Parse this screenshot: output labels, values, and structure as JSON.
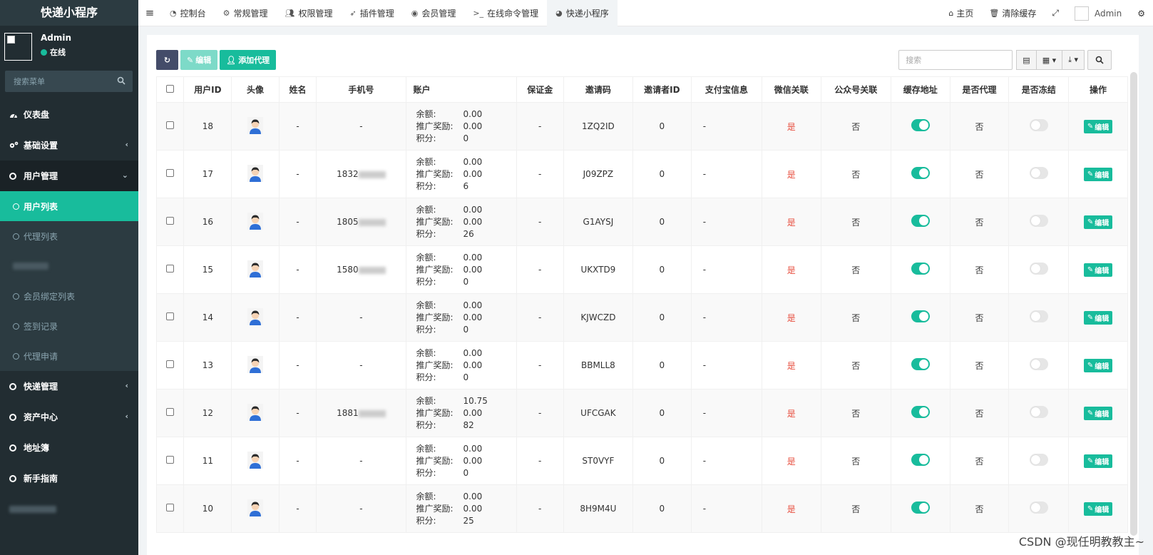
{
  "app": {
    "title": "快递小程序"
  },
  "user": {
    "name": "Admin",
    "status": "在线"
  },
  "sidebar": {
    "search_placeholder": "搜索菜单",
    "items": [
      {
        "label": "仪表盘"
      },
      {
        "label": "基础设置"
      },
      {
        "label": "用户管理"
      },
      {
        "label": "快递管理"
      },
      {
        "label": "资产中心"
      },
      {
        "label": "地址簿"
      },
      {
        "label": "新手指南"
      }
    ],
    "submenu": [
      {
        "label": "用户列表"
      },
      {
        "label": "代理列表"
      },
      {
        "label": "会员绑定列表"
      },
      {
        "label": "签到记录"
      },
      {
        "label": "代理申请"
      }
    ]
  },
  "topnav": {
    "tabs": [
      {
        "label": "控制台"
      },
      {
        "label": "常规管理"
      },
      {
        "label": "权限管理"
      },
      {
        "label": "插件管理"
      },
      {
        "label": "会员管理"
      },
      {
        "label": "在线命令管理"
      },
      {
        "label": "快递小程序"
      }
    ],
    "home": "主页",
    "clear_cache": "清除缓存",
    "admin": "Admin"
  },
  "toolbar": {
    "edit": "编辑",
    "add_agent": "添加代理",
    "search_placeholder": "搜索"
  },
  "table": {
    "headers": [
      "用户ID",
      "头像",
      "姓名",
      "手机号",
      "账户",
      "保证金",
      "邀请码",
      "邀请者ID",
      "支付宝信息",
      "微信关联",
      "公众号关联",
      "缓存地址",
      "是否代理",
      "是否冻结",
      "操作"
    ],
    "account_labels": {
      "balance": "余额:",
      "reward": "推广奖励:",
      "points": "积分:"
    },
    "edit_label": "编辑",
    "rows": [
      {
        "id": "18",
        "name": "-",
        "phone": "-",
        "balance": "0.00",
        "reward": "0.00",
        "points": "0",
        "deposit": "-",
        "code": "1ZQ2ID",
        "inviter": "0",
        "alipay": "-",
        "wechat": "是",
        "mp": "否",
        "cache": true,
        "agent": "否",
        "frozen": false
      },
      {
        "id": "17",
        "name": "-",
        "phone": "1832",
        "balance": "0.00",
        "reward": "0.00",
        "points": "6",
        "deposit": "-",
        "code": "J09ZPZ",
        "inviter": "0",
        "alipay": "-",
        "wechat": "是",
        "mp": "否",
        "cache": true,
        "agent": "否",
        "frozen": false
      },
      {
        "id": "16",
        "name": "-",
        "phone": "1805",
        "balance": "0.00",
        "reward": "0.00",
        "points": "26",
        "deposit": "-",
        "code": "G1AYSJ",
        "inviter": "0",
        "alipay": "-",
        "wechat": "是",
        "mp": "否",
        "cache": true,
        "agent": "否",
        "frozen": false
      },
      {
        "id": "15",
        "name": "-",
        "phone": "1580",
        "balance": "0.00",
        "reward": "0.00",
        "points": "0",
        "deposit": "-",
        "code": "UKXTD9",
        "inviter": "0",
        "alipay": "-",
        "wechat": "是",
        "mp": "否",
        "cache": true,
        "agent": "否",
        "frozen": false
      },
      {
        "id": "14",
        "name": "-",
        "phone": "-",
        "balance": "0.00",
        "reward": "0.00",
        "points": "0",
        "deposit": "-",
        "code": "KJWCZD",
        "inviter": "0",
        "alipay": "-",
        "wechat": "是",
        "mp": "否",
        "cache": true,
        "agent": "否",
        "frozen": false
      },
      {
        "id": "13",
        "name": "-",
        "phone": "-",
        "balance": "0.00",
        "reward": "0.00",
        "points": "0",
        "deposit": "-",
        "code": "BBMLL8",
        "inviter": "0",
        "alipay": "-",
        "wechat": "是",
        "mp": "否",
        "cache": true,
        "agent": "否",
        "frozen": false
      },
      {
        "id": "12",
        "name": "-",
        "phone": "1881",
        "balance": "10.75",
        "reward": "0.00",
        "points": "82",
        "deposit": "-",
        "code": "UFCGAK",
        "inviter": "0",
        "alipay": "-",
        "wechat": "是",
        "mp": "否",
        "cache": true,
        "agent": "否",
        "frozen": false
      },
      {
        "id": "11",
        "name": "-",
        "phone": "-",
        "balance": "0.00",
        "reward": "0.00",
        "points": "0",
        "deposit": "-",
        "code": "ST0VYF",
        "inviter": "0",
        "alipay": "-",
        "wechat": "是",
        "mp": "否",
        "cache": true,
        "agent": "否",
        "frozen": false
      },
      {
        "id": "10",
        "name": "-",
        "phone": "-",
        "balance": "0.00",
        "reward": "0.00",
        "points": "25",
        "deposit": "-",
        "code": "8H9M4U",
        "inviter": "0",
        "alipay": "-",
        "wechat": "是",
        "mp": "否",
        "cache": true,
        "agent": "否",
        "frozen": false
      }
    ]
  },
  "watermark": "CSDN @现任明教教主~",
  "colors": {
    "accent": "#18bc9c",
    "sidebar": "#222d32",
    "danger": "#e74c3c"
  }
}
